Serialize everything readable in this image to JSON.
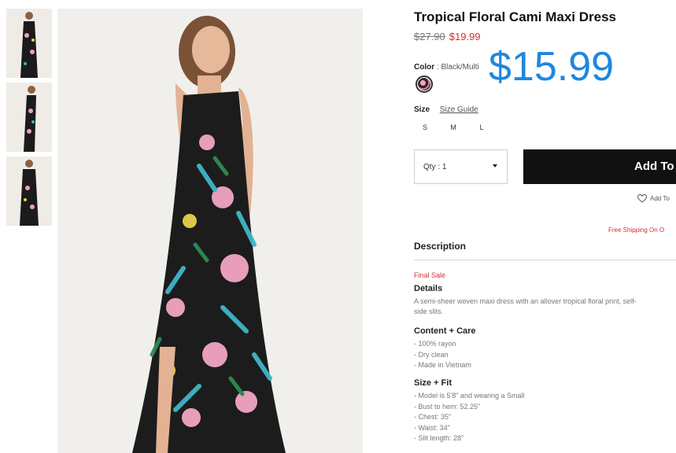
{
  "product": {
    "title": "Tropical Floral Cami Maxi Dress",
    "price_old": "$27.90",
    "price_sale": "$19.99",
    "promo_price": "$15.99",
    "color_label": "Color",
    "color_sep": ":",
    "color_value": "Black/Multi",
    "size_label": "Size",
    "size_guide": "Size Guide",
    "sizes": [
      "S",
      "M",
      "L"
    ],
    "qty_label": "Qty : 1",
    "add_button": "Add To",
    "wishlist": "Add To",
    "shipping": "Free Shipping On O"
  },
  "description": {
    "heading": "Description",
    "final_sale": "Final Sale",
    "details_heading": "Details",
    "details_line1": "A semi-sheer woven maxi dress with an allover tropical floral print, self-",
    "details_line2": "side slits.",
    "content_heading": "Content + Care",
    "content_items": [
      "- 100% rayon",
      "- Dry clean",
      "- Made in Vietnam"
    ],
    "fit_heading": "Size + Fit",
    "fit_items": [
      "- Model is 5'8\" and wearing a Small",
      "- Bust to hem: 52.25\"",
      "- Chest: 35\"",
      "- Waist: 34\"",
      "- Slit length: 28\""
    ]
  },
  "icons": {
    "wishlist": "heart-icon",
    "qty_dropdown": "caret-down-icon"
  },
  "colors": {
    "accent_sale": "#d32f2f",
    "promo_blue": "#1f86e0",
    "button_bg": "#111111"
  }
}
